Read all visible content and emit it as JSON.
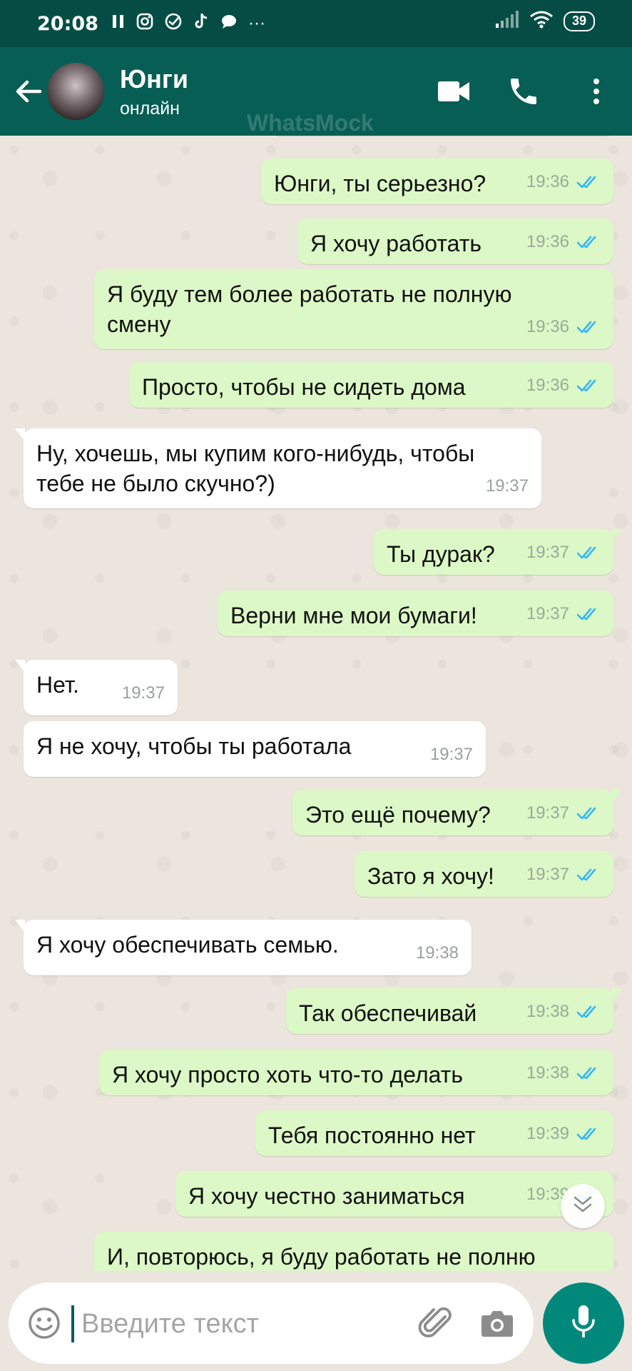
{
  "status_bar": {
    "time": "20:08",
    "battery": "39",
    "more": "···"
  },
  "header": {
    "contact_name": "Юнги",
    "contact_status": "онлайн",
    "watermark": "WhatsMock"
  },
  "messages": [
    {
      "dir": "out",
      "text": "Юнги, ты серьезно?",
      "time": "19:36"
    },
    {
      "dir": "out",
      "text": "Я хочу работать",
      "time": "19:36"
    },
    {
      "dir": "out",
      "text": "Я буду тем более работать не полную смену",
      "time": "19:36"
    },
    {
      "dir": "out",
      "text": "Просто, чтобы не сидеть дома",
      "time": "19:36"
    },
    {
      "dir": "in",
      "text": "Ну, хочешь, мы купим кого-нибудь, чтобы тебе не было скучно?)",
      "time": "19:37"
    },
    {
      "dir": "out",
      "text": "Ты дурак?",
      "time": "19:37"
    },
    {
      "dir": "out",
      "text": "Верни мне мои бумаги!",
      "time": "19:37"
    },
    {
      "dir": "in",
      "text": "Нет.",
      "time": "19:37"
    },
    {
      "dir": "in",
      "text": "Я не хочу, чтобы ты работала",
      "time": "19:37"
    },
    {
      "dir": "out",
      "text": "Это ещё почему?",
      "time": "19:37"
    },
    {
      "dir": "out",
      "text": "Зато я хочу!",
      "time": "19:37"
    },
    {
      "dir": "in",
      "text": "Я хочу обеспечивать семью.",
      "time": "19:38"
    },
    {
      "dir": "out",
      "text": "Так обеспечивай",
      "time": "19:38"
    },
    {
      "dir": "out",
      "text": "Я хочу просто хоть что-то делать",
      "time": "19:38"
    },
    {
      "dir": "out",
      "text": "Тебя постоянно нет",
      "time": "19:39"
    },
    {
      "dir": "out",
      "text": "Я хочу честно заниматься",
      "time": "19:39"
    },
    {
      "dir": "out",
      "text": "И, повторюсь, я буду работать не полню",
      "time": ""
    }
  ],
  "input": {
    "placeholder": "Введите текст"
  },
  "colors": {
    "header": "#075e54",
    "status_bar": "#054d44",
    "outgoing_bubble": "#dcf8c6",
    "incoming_bubble": "#ffffff",
    "chat_background": "#ece5dd",
    "read_ticks": "#34b7f1",
    "mic_button": "#00897b"
  }
}
